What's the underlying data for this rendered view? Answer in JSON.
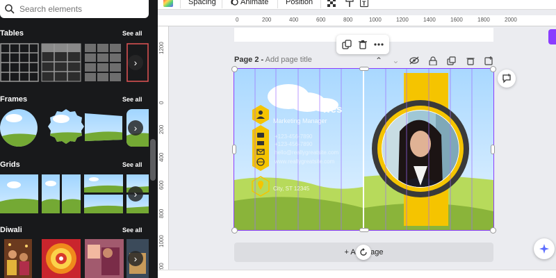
{
  "search": {
    "placeholder": "Search elements"
  },
  "sections": [
    {
      "title": "Tables",
      "see_all": "See all"
    },
    {
      "title": "Frames",
      "see_all": "See all"
    },
    {
      "title": "Grids",
      "see_all": "See all"
    },
    {
      "title": "Diwali",
      "see_all": "See all"
    }
  ],
  "toolbar": {
    "spacing": "Spacing",
    "animate": "Animate",
    "position": "Position"
  },
  "ruler_top": [
    "0",
    "200",
    "400",
    "600",
    "800",
    "1000",
    "1200",
    "1400",
    "1600",
    "1800",
    "2000"
  ],
  "ruler_left": [
    "1200",
    "0",
    "200",
    "400",
    "600",
    "800",
    "1000",
    "1200"
  ],
  "page": {
    "label": "Page 2 -",
    "title_placeholder": "Add page title"
  },
  "card": {
    "name_partial": "wes",
    "job_title": "Marketing Manager",
    "phone_1": "+123-456-7890",
    "phone_2": "+123-456-7890",
    "email": "hello@reallygreatsite.com",
    "website": "www.reallygreatsite.com",
    "address": "City, ST 12345"
  },
  "add_page": "+ Add page",
  "colors": {
    "accent": "#8b3dff",
    "yellow": "#f5c400",
    "dark": "#3a3a3a",
    "sky": "#bfe3ff",
    "grass": "#8db33a"
  }
}
